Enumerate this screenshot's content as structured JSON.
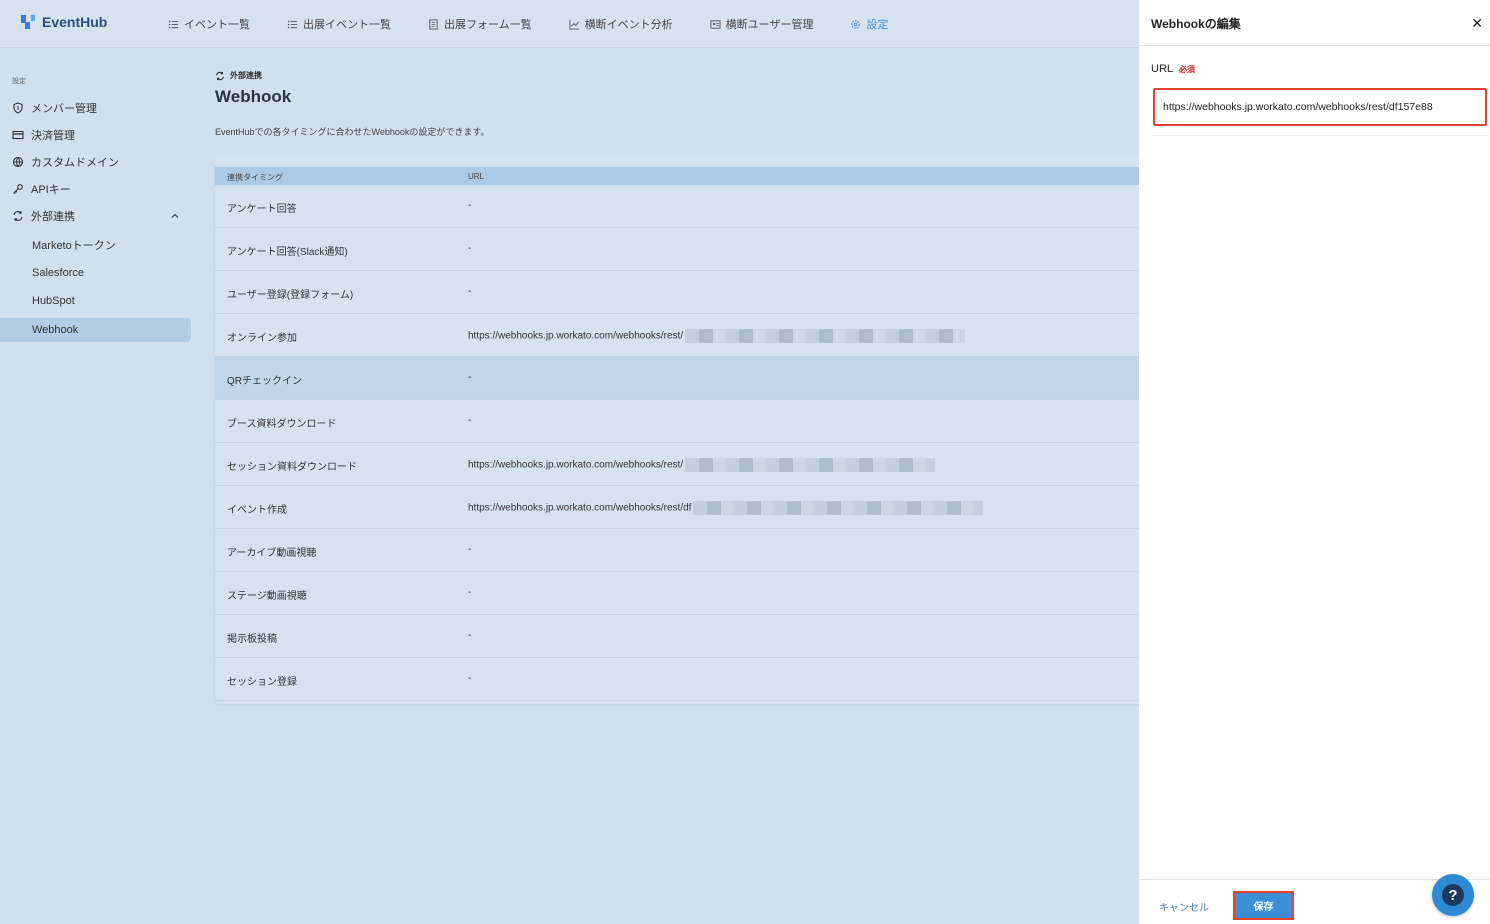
{
  "app": {
    "brand": "EventHub"
  },
  "nav": {
    "items": [
      {
        "label": "イベント一覧",
        "icon": "list-icon"
      },
      {
        "label": "出展イベント一覧",
        "icon": "list-icon"
      },
      {
        "label": "出展フォーム一覧",
        "icon": "form-icon"
      },
      {
        "label": "横断イベント分析",
        "icon": "chart-icon"
      },
      {
        "label": "横断ユーザー管理",
        "icon": "user-card-icon"
      },
      {
        "label": "設定",
        "icon": "gear-icon"
      }
    ],
    "active": "設定"
  },
  "sidebar": {
    "section_label": "設定",
    "items": [
      {
        "label": "メンバー管理",
        "icon": "shield-icon"
      },
      {
        "label": "決済管理",
        "icon": "card-icon"
      },
      {
        "label": "カスタムドメイン",
        "icon": "globe-icon"
      },
      {
        "label": "APIキー",
        "icon": "key-icon"
      },
      {
        "label": "外部連携",
        "icon": "sync-icon"
      }
    ],
    "sub_items": [
      {
        "label": "Marketoトークン"
      },
      {
        "label": "Salesforce"
      },
      {
        "label": "HubSpot"
      },
      {
        "label": "Webhook"
      }
    ],
    "selected": "Webhook"
  },
  "main": {
    "breadcrumb": "外部連携",
    "title": "Webhook",
    "description": "EventHubでの各タイミングに合わせたWebhookの設定ができます。",
    "table": {
      "headers": [
        "連携タイミング",
        "URL"
      ],
      "rows": [
        {
          "timing": "アンケート回答",
          "url": "-"
        },
        {
          "timing": "アンケート回答(Slack通知)",
          "url": "-"
        },
        {
          "timing": "ユーザー登録(登録フォーム)",
          "url": "-"
        },
        {
          "timing": "オンライン参加",
          "url": "https://webhooks.jp.workato.com/webhooks/rest/",
          "redacted": true
        },
        {
          "timing": "QRチェックイン",
          "url": "-",
          "highlight": true
        },
        {
          "timing": "ブース資料ダウンロード",
          "url": "-"
        },
        {
          "timing": "セッション資料ダウンロード",
          "url": "https://webhooks.jp.workato.com/webhooks/rest/",
          "redacted": true
        },
        {
          "timing": "イベント作成",
          "url": "https://webhooks.jp.workato.com/webhooks/rest/df",
          "redacted": true
        },
        {
          "timing": "アーカイブ動画視聴",
          "url": "-"
        },
        {
          "timing": "ステージ動画視聴",
          "url": "-"
        },
        {
          "timing": "掲示板投稿",
          "url": "-"
        },
        {
          "timing": "セッション登録",
          "url": "-"
        }
      ]
    }
  },
  "drawer": {
    "title": "Webhookの編集",
    "close_icon": "close-icon",
    "url_label": "URL",
    "required_label": "必須",
    "url_value": "https://webhooks.jp.workato.com/webhooks/rest/df157e88",
    "cancel_label": "キャンセル",
    "save_label": "保存"
  },
  "help": {
    "icon": "help-icon"
  },
  "colors": {
    "accent": "#3b8fd6",
    "highlight_border": "#e6402e",
    "required": "#d0262a"
  }
}
